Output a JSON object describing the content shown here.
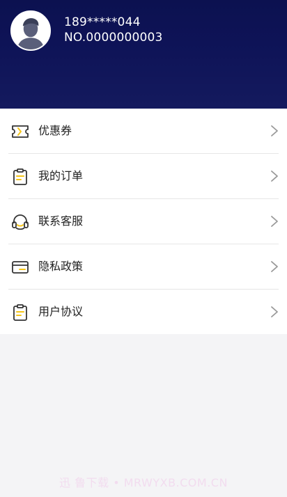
{
  "user": {
    "phone": "189*****044",
    "number": "NO.0000000003"
  },
  "menu": [
    {
      "label": "优惠券",
      "icon": "ticket-icon"
    },
    {
      "label": "我的订单",
      "icon": "clipboard-icon"
    },
    {
      "label": "联系客服",
      "icon": "headset-icon"
    },
    {
      "label": "隐私政策",
      "icon": "card-icon"
    },
    {
      "label": "用户协议",
      "icon": "clipboard-icon"
    }
  ],
  "watermark": "迅 鲁下载 • MRWYXB.COM.CN",
  "colors": {
    "header_bg": "#0e1357",
    "accent_yellow": "#f5c518",
    "icon_stroke": "#333333"
  }
}
